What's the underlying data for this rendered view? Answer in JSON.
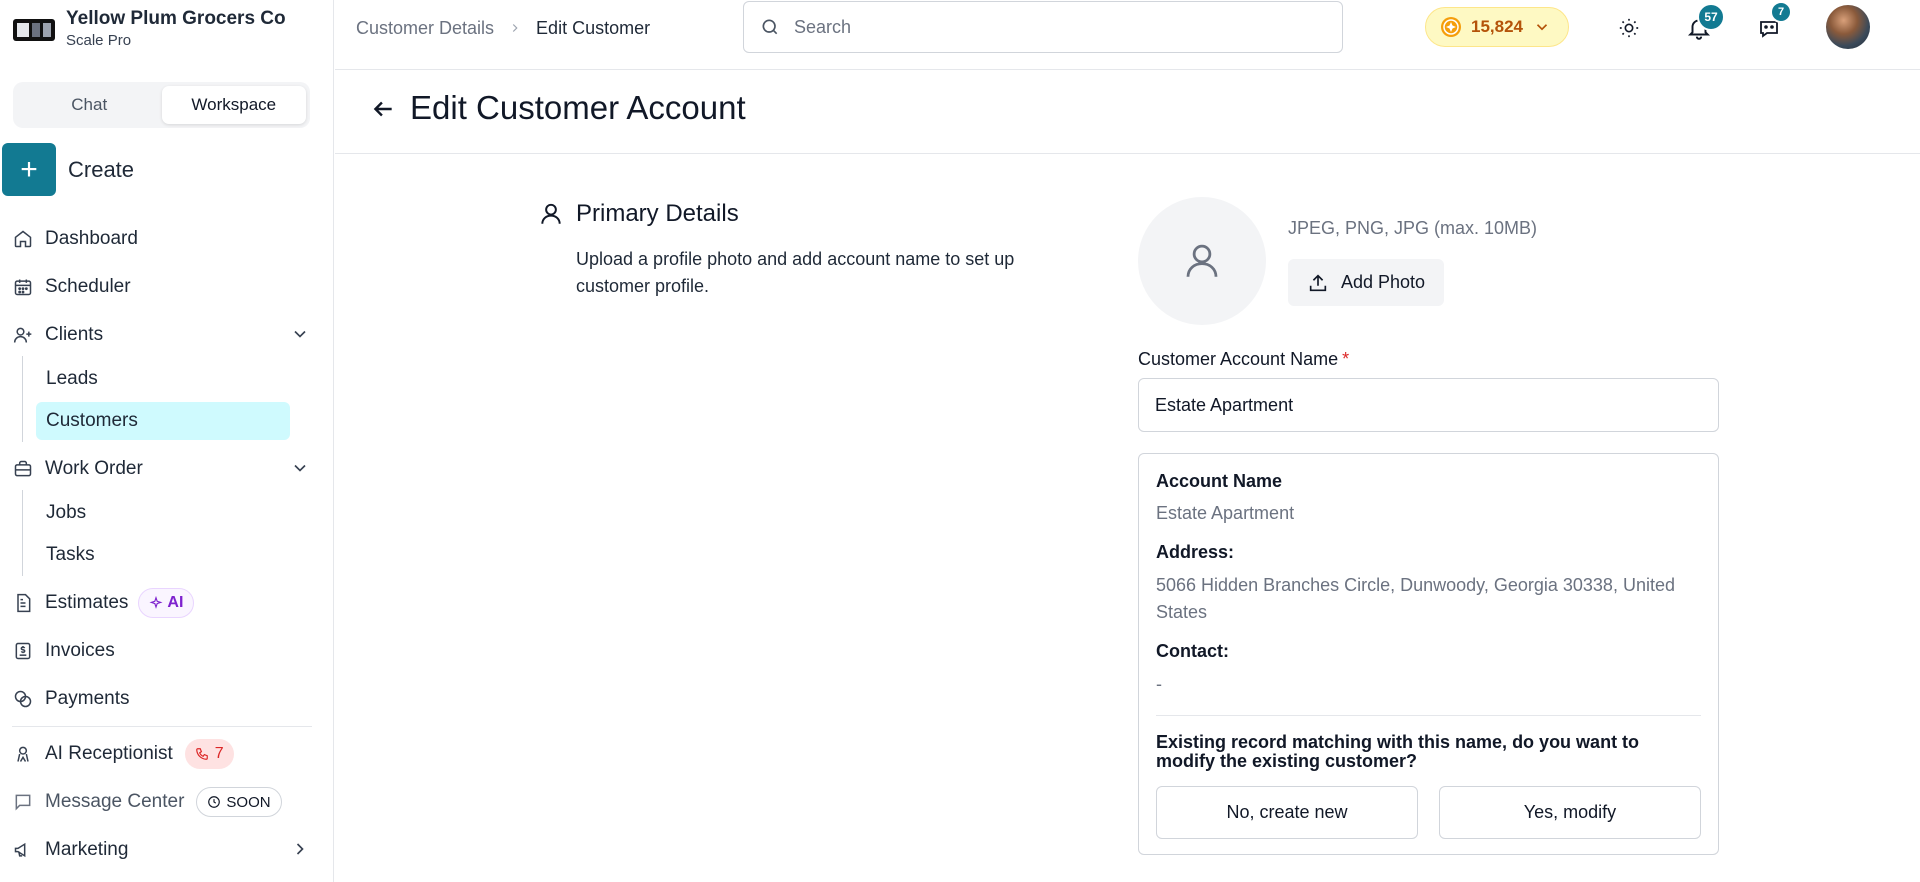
{
  "brand": {
    "name": "Yellow Plum Grocers Co",
    "plan": "Scale Pro"
  },
  "sidebar": {
    "segments": [
      "Chat",
      "Workspace"
    ],
    "active_segment": "Workspace",
    "create_label": "Create",
    "items": {
      "dashboard": "Dashboard",
      "scheduler": "Scheduler",
      "clients": "Clients",
      "leads": "Leads",
      "customers": "Customers",
      "work_order": "Work Order",
      "jobs": "Jobs",
      "tasks": "Tasks",
      "estimates": "Estimates",
      "estimates_badge": "AI",
      "invoices": "Invoices",
      "payments": "Payments",
      "ai_receptionist": "AI Receptionist",
      "ai_receptionist_badge": "7",
      "message_center": "Message Center",
      "message_center_badge": "SOON",
      "marketing": "Marketing"
    }
  },
  "topbar": {
    "breadcrumb": [
      "Customer Details",
      "Edit Customer"
    ],
    "search_placeholder": "Search",
    "coins": "15,824",
    "notifications_count": "57",
    "messages_count": "7"
  },
  "page": {
    "title": "Edit Customer Account",
    "section_title": "Primary Details",
    "section_desc": "Upload a profile photo and add account name to set up customer profile.",
    "photo_hint": "JPEG, PNG, JPG (max. 10MB)",
    "add_photo_label": "Add Photo",
    "account_name_label": "Customer Account Name",
    "required_mark": "*",
    "account_name_value": "Estate Apartment"
  },
  "match_card": {
    "account_name_label": "Account Name",
    "account_name_value": "Estate Apartment",
    "address_label": "Address:",
    "address_value": "5066 Hidden Branches Circle, Dunwoody, Georgia 30338, United States",
    "contact_label": "Contact:",
    "contact_value": "-",
    "question": "Existing record matching with this name, do you want to modify the existing customer?",
    "no_button": "No, create new",
    "yes_button": "Yes, modify"
  },
  "colors": {
    "accent": "#127a92",
    "active_nav_bg": "#cffafe",
    "required": "#dc2626"
  }
}
